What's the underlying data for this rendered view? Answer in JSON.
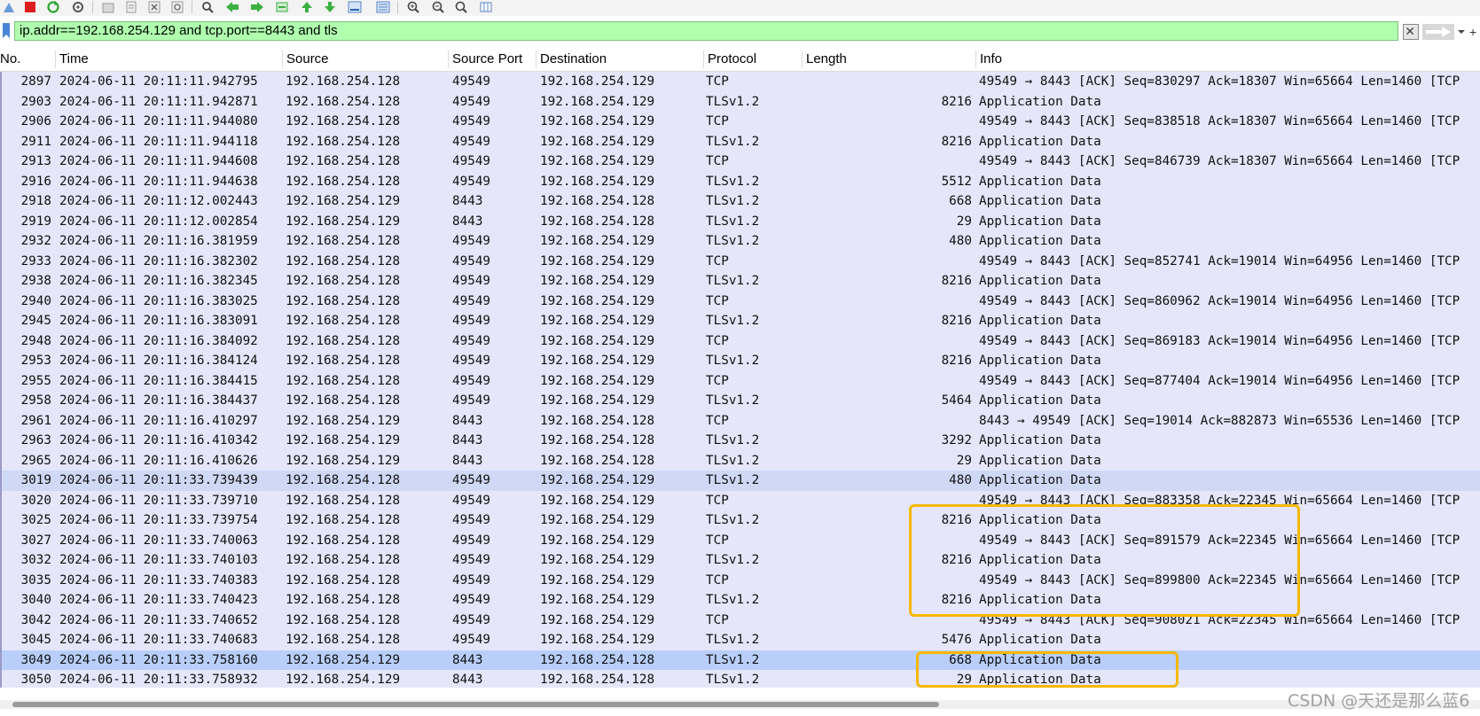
{
  "filter": {
    "expression": "ip.addr==192.168.254.129 and tcp.port==8443 and tls"
  },
  "columns": {
    "no": "No.",
    "time": "Time",
    "source": "Source",
    "source_port": "Source Port",
    "destination": "Destination",
    "protocol": "Protocol",
    "length": "Length",
    "info": "Info"
  },
  "packets": [
    {
      "no": "2897",
      "time": "2024-06-11 20:11:11.942795",
      "source": "192.168.254.128",
      "source_port": "49549",
      "destination": "192.168.254.129",
      "protocol": "TCP",
      "length": "",
      "info": "49549 → 8443 [ACK] Seq=830297 Ack=18307 Win=65664 Len=1460 [TCP"
    },
    {
      "no": "2903",
      "time": "2024-06-11 20:11:11.942871",
      "source": "192.168.254.128",
      "source_port": "49549",
      "destination": "192.168.254.129",
      "protocol": "TLSv1.2",
      "length": "8216",
      "info": "Application Data"
    },
    {
      "no": "2906",
      "time": "2024-06-11 20:11:11.944080",
      "source": "192.168.254.128",
      "source_port": "49549",
      "destination": "192.168.254.129",
      "protocol": "TCP",
      "length": "",
      "info": "49549 → 8443 [ACK] Seq=838518 Ack=18307 Win=65664 Len=1460 [TCP"
    },
    {
      "no": "2911",
      "time": "2024-06-11 20:11:11.944118",
      "source": "192.168.254.128",
      "source_port": "49549",
      "destination": "192.168.254.129",
      "protocol": "TLSv1.2",
      "length": "8216",
      "info": "Application Data"
    },
    {
      "no": "2913",
      "time": "2024-06-11 20:11:11.944608",
      "source": "192.168.254.128",
      "source_port": "49549",
      "destination": "192.168.254.129",
      "protocol": "TCP",
      "length": "",
      "info": "49549 → 8443 [ACK] Seq=846739 Ack=18307 Win=65664 Len=1460 [TCP"
    },
    {
      "no": "2916",
      "time": "2024-06-11 20:11:11.944638",
      "source": "192.168.254.128",
      "source_port": "49549",
      "destination": "192.168.254.129",
      "protocol": "TLSv1.2",
      "length": "5512",
      "info": "Application Data"
    },
    {
      "no": "2918",
      "time": "2024-06-11 20:11:12.002443",
      "source": "192.168.254.129",
      "source_port": "8443",
      "destination": "192.168.254.128",
      "protocol": "TLSv1.2",
      "length": "668",
      "info": "Application Data"
    },
    {
      "no": "2919",
      "time": "2024-06-11 20:11:12.002854",
      "source": "192.168.254.129",
      "source_port": "8443",
      "destination": "192.168.254.128",
      "protocol": "TLSv1.2",
      "length": "29",
      "info": "Application Data"
    },
    {
      "no": "2932",
      "time": "2024-06-11 20:11:16.381959",
      "source": "192.168.254.128",
      "source_port": "49549",
      "destination": "192.168.254.129",
      "protocol": "TLSv1.2",
      "length": "480",
      "info": "Application Data"
    },
    {
      "no": "2933",
      "time": "2024-06-11 20:11:16.382302",
      "source": "192.168.254.128",
      "source_port": "49549",
      "destination": "192.168.254.129",
      "protocol": "TCP",
      "length": "",
      "info": "49549 → 8443 [ACK] Seq=852741 Ack=19014 Win=64956 Len=1460 [TCP"
    },
    {
      "no": "2938",
      "time": "2024-06-11 20:11:16.382345",
      "source": "192.168.254.128",
      "source_port": "49549",
      "destination": "192.168.254.129",
      "protocol": "TLSv1.2",
      "length": "8216",
      "info": "Application Data"
    },
    {
      "no": "2940",
      "time": "2024-06-11 20:11:16.383025",
      "source": "192.168.254.128",
      "source_port": "49549",
      "destination": "192.168.254.129",
      "protocol": "TCP",
      "length": "",
      "info": "49549 → 8443 [ACK] Seq=860962 Ack=19014 Win=64956 Len=1460 [TCP"
    },
    {
      "no": "2945",
      "time": "2024-06-11 20:11:16.383091",
      "source": "192.168.254.128",
      "source_port": "49549",
      "destination": "192.168.254.129",
      "protocol": "TLSv1.2",
      "length": "8216",
      "info": "Application Data"
    },
    {
      "no": "2948",
      "time": "2024-06-11 20:11:16.384092",
      "source": "192.168.254.128",
      "source_port": "49549",
      "destination": "192.168.254.129",
      "protocol": "TCP",
      "length": "",
      "info": "49549 → 8443 [ACK] Seq=869183 Ack=19014 Win=64956 Len=1460 [TCP"
    },
    {
      "no": "2953",
      "time": "2024-06-11 20:11:16.384124",
      "source": "192.168.254.128",
      "source_port": "49549",
      "destination": "192.168.254.129",
      "protocol": "TLSv1.2",
      "length": "8216",
      "info": "Application Data"
    },
    {
      "no": "2955",
      "time": "2024-06-11 20:11:16.384415",
      "source": "192.168.254.128",
      "source_port": "49549",
      "destination": "192.168.254.129",
      "protocol": "TCP",
      "length": "",
      "info": "49549 → 8443 [ACK] Seq=877404 Ack=19014 Win=64956 Len=1460 [TCP"
    },
    {
      "no": "2958",
      "time": "2024-06-11 20:11:16.384437",
      "source": "192.168.254.128",
      "source_port": "49549",
      "destination": "192.168.254.129",
      "protocol": "TLSv1.2",
      "length": "5464",
      "info": "Application Data"
    },
    {
      "no": "2961",
      "time": "2024-06-11 20:11:16.410297",
      "source": "192.168.254.129",
      "source_port": "8443",
      "destination": "192.168.254.128",
      "protocol": "TCP",
      "length": "",
      "info": "8443 → 49549 [ACK] Seq=19014 Ack=882873 Win=65536 Len=1460 [TCP"
    },
    {
      "no": "2963",
      "time": "2024-06-11 20:11:16.410342",
      "source": "192.168.254.129",
      "source_port": "8443",
      "destination": "192.168.254.128",
      "protocol": "TLSv1.2",
      "length": "3292",
      "info": "Application Data"
    },
    {
      "no": "2965",
      "time": "2024-06-11 20:11:16.410626",
      "source": "192.168.254.129",
      "source_port": "8443",
      "destination": "192.168.254.128",
      "protocol": "TLSv1.2",
      "length": "29",
      "info": "Application Data"
    },
    {
      "no": "3019",
      "time": "2024-06-11 20:11:33.739439",
      "source": "192.168.254.128",
      "source_port": "49549",
      "destination": "192.168.254.129",
      "protocol": "TLSv1.2",
      "length": "480",
      "info": "Application Data"
    },
    {
      "no": "3020",
      "time": "2024-06-11 20:11:33.739710",
      "source": "192.168.254.128",
      "source_port": "49549",
      "destination": "192.168.254.129",
      "protocol": "TCP",
      "length": "",
      "info": "49549 → 8443 [ACK] Seq=883358 Ack=22345 Win=65664 Len=1460 [TCP"
    },
    {
      "no": "3025",
      "time": "2024-06-11 20:11:33.739754",
      "source": "192.168.254.128",
      "source_port": "49549",
      "destination": "192.168.254.129",
      "protocol": "TLSv1.2",
      "length": "8216",
      "info": "Application Data"
    },
    {
      "no": "3027",
      "time": "2024-06-11 20:11:33.740063",
      "source": "192.168.254.128",
      "source_port": "49549",
      "destination": "192.168.254.129",
      "protocol": "TCP",
      "length": "",
      "info": "49549 → 8443 [ACK] Seq=891579 Ack=22345 Win=65664 Len=1460 [TCP"
    },
    {
      "no": "3032",
      "time": "2024-06-11 20:11:33.740103",
      "source": "192.168.254.128",
      "source_port": "49549",
      "destination": "192.168.254.129",
      "protocol": "TLSv1.2",
      "length": "8216",
      "info": "Application Data"
    },
    {
      "no": "3035",
      "time": "2024-06-11 20:11:33.740383",
      "source": "192.168.254.128",
      "source_port": "49549",
      "destination": "192.168.254.129",
      "protocol": "TCP",
      "length": "",
      "info": "49549 → 8443 [ACK] Seq=899800 Ack=22345 Win=65664 Len=1460 [TCP"
    },
    {
      "no": "3040",
      "time": "2024-06-11 20:11:33.740423",
      "source": "192.168.254.128",
      "source_port": "49549",
      "destination": "192.168.254.129",
      "protocol": "TLSv1.2",
      "length": "8216",
      "info": "Application Data"
    },
    {
      "no": "3042",
      "time": "2024-06-11 20:11:33.740652",
      "source": "192.168.254.128",
      "source_port": "49549",
      "destination": "192.168.254.129",
      "protocol": "TCP",
      "length": "",
      "info": "49549 → 8443 [ACK] Seq=908021 Ack=22345 Win=65664 Len=1460 [TCP"
    },
    {
      "no": "3045",
      "time": "2024-06-11 20:11:33.740683",
      "source": "192.168.254.128",
      "source_port": "49549",
      "destination": "192.168.254.129",
      "protocol": "TLSv1.2",
      "length": "5476",
      "info": "Application Data"
    },
    {
      "no": "3049",
      "time": "2024-06-11 20:11:33.758160",
      "source": "192.168.254.129",
      "source_port": "8443",
      "destination": "192.168.254.128",
      "protocol": "TLSv1.2",
      "length": "668",
      "info": "Application Data"
    },
    {
      "no": "3050",
      "time": "2024-06-11 20:11:33.758932",
      "source": "192.168.254.129",
      "source_port": "8443",
      "destination": "192.168.254.128",
      "protocol": "TLSv1.2",
      "length": "29",
      "info": "Application Data"
    }
  ],
  "watermark": "CSDN @天还是那么蓝6",
  "colors": {
    "row_bg": "#e6e6fa",
    "filter_valid_bg": "#afffaf",
    "annotation_box": "#f5b800"
  }
}
